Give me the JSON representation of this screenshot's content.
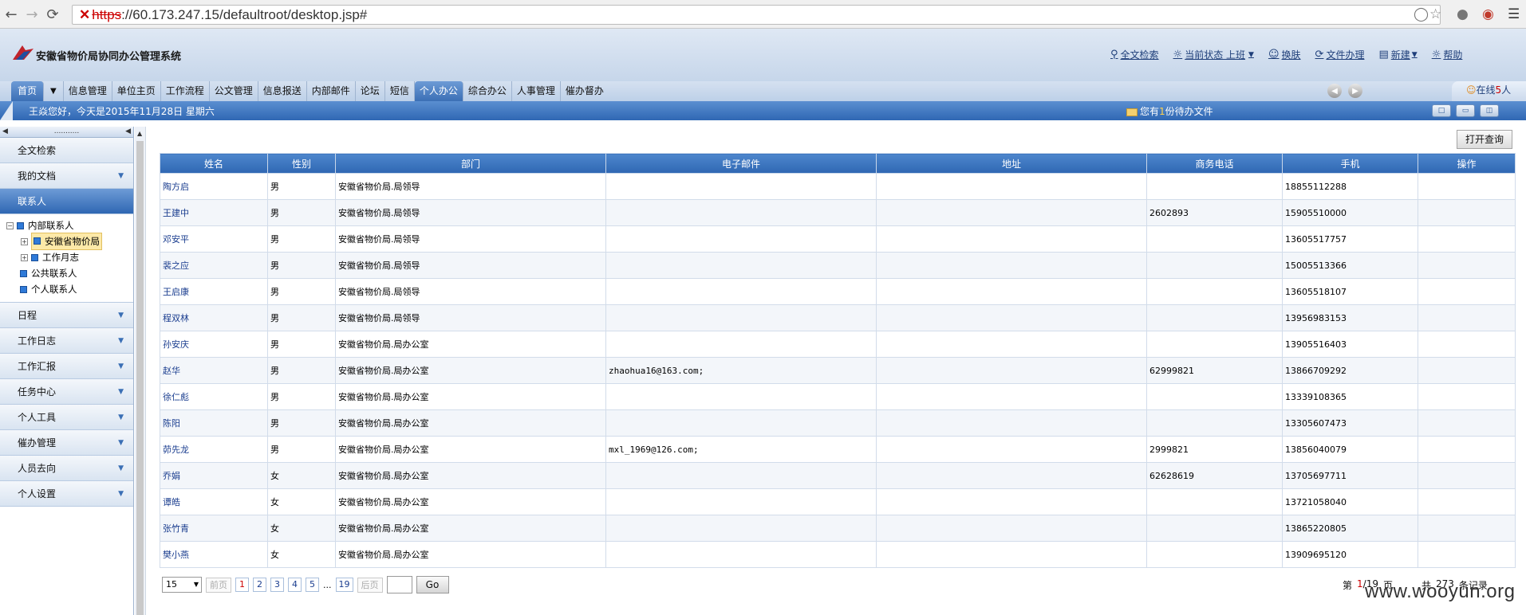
{
  "browser": {
    "url_scheme": "https",
    "url_rest": "://60.173.247.15/defaultroot/desktop.jsp#"
  },
  "app": {
    "title": "安徽省物价局协同办公管理系统",
    "header_links": [
      {
        "label": "全文检索",
        "icon": "search-icon"
      },
      {
        "label": "当前状态 上班",
        "icon": "sun-icon"
      },
      {
        "label": "换肤",
        "icon": "user-icon"
      },
      {
        "label": "文件办理",
        "icon": "refresh-icon"
      },
      {
        "label": "新建",
        "icon": "document-icon"
      },
      {
        "label": "帮助",
        "icon": "bulb-icon"
      }
    ]
  },
  "nav": {
    "items": [
      "首页",
      "信息管理",
      "单位主页",
      "工作流程",
      "公文管理",
      "信息报送",
      "内部邮件",
      "论坛",
      "短信",
      "个人办公",
      "综合办公",
      "人事管理",
      "催办督办"
    ],
    "active": "个人办公",
    "online_label": "在线",
    "online_count": "5",
    "online_suffix": "人"
  },
  "welcome": {
    "greeting": "王焱您好，今天是2015年11月28日 星期六",
    "pending_prefix": "您有",
    "pending_count": "1",
    "pending_suffix": "份待办文件"
  },
  "sidebar": {
    "collapse_dots": "...........",
    "top_items": [
      "全文检索",
      "我的文档"
    ],
    "contacts_label": "联系人",
    "tree": {
      "internal": "内部联系人",
      "org": "安徽省物价局",
      "log": "工作月志",
      "public": "公共联系人",
      "personal": "个人联系人"
    },
    "bottom_items": [
      "日程",
      "工作日志",
      "工作汇报",
      "任务中心",
      "个人工具",
      "催办管理",
      "人员去向",
      "个人设置"
    ]
  },
  "content": {
    "open_search_label": "打开查询",
    "columns": [
      "姓名",
      "性别",
      "部门",
      "电子邮件",
      "地址",
      "商务电话",
      "手机",
      "操作"
    ],
    "rows": [
      {
        "name": "陶方启",
        "sex": "男",
        "dept": "安徽省物价局.局领导",
        "email": "",
        "addr": "",
        "phone": "",
        "mobile": "18855112288"
      },
      {
        "name": "王建中",
        "sex": "男",
        "dept": "安徽省物价局.局领导",
        "email": "",
        "addr": "",
        "phone": "2602893",
        "mobile": "15905510000"
      },
      {
        "name": "邓安平",
        "sex": "男",
        "dept": "安徽省物价局.局领导",
        "email": "",
        "addr": "",
        "phone": "",
        "mobile": "13605517757"
      },
      {
        "name": "裴之应",
        "sex": "男",
        "dept": "安徽省物价局.局领导",
        "email": "",
        "addr": "",
        "phone": "",
        "mobile": "15005513366"
      },
      {
        "name": "王启康",
        "sex": "男",
        "dept": "安徽省物价局.局领导",
        "email": "",
        "addr": "",
        "phone": "",
        "mobile": "13605518107"
      },
      {
        "name": "程双林",
        "sex": "男",
        "dept": "安徽省物价局.局领导",
        "email": "",
        "addr": "",
        "phone": "",
        "mobile": "13956983153"
      },
      {
        "name": "孙安庆",
        "sex": "男",
        "dept": "安徽省物价局.局办公室",
        "email": "",
        "addr": "",
        "phone": "",
        "mobile": "13905516403"
      },
      {
        "name": "赵华",
        "sex": "男",
        "dept": "安徽省物价局.局办公室",
        "email": "zhaohua16@163.com;",
        "addr": "",
        "phone": "62999821",
        "mobile": "13866709292"
      },
      {
        "name": "徐仁彪",
        "sex": "男",
        "dept": "安徽省物价局.局办公室",
        "email": "",
        "addr": "",
        "phone": "",
        "mobile": "13339108365"
      },
      {
        "name": "陈阳",
        "sex": "男",
        "dept": "安徽省物价局.局办公室",
        "email": "",
        "addr": "",
        "phone": "",
        "mobile": "13305607473"
      },
      {
        "name": "茆先龙",
        "sex": "男",
        "dept": "安徽省物价局.局办公室",
        "email": "mxl_1969@126.com;",
        "addr": "",
        "phone": "2999821",
        "mobile": "13856040079"
      },
      {
        "name": "乔娟",
        "sex": "女",
        "dept": "安徽省物价局.局办公室",
        "email": "",
        "addr": "",
        "phone": "62628619",
        "mobile": "13705697711"
      },
      {
        "name": "谭皓",
        "sex": "女",
        "dept": "安徽省物价局.局办公室",
        "email": "",
        "addr": "",
        "phone": "",
        "mobile": "13721058040"
      },
      {
        "name": "张竹青",
        "sex": "女",
        "dept": "安徽省物价局.局办公室",
        "email": "",
        "addr": "",
        "phone": "",
        "mobile": "13865220805"
      },
      {
        "name": "樊小燕",
        "sex": "女",
        "dept": "安徽省物价局.局办公室",
        "email": "",
        "addr": "",
        "phone": "",
        "mobile": "13909695120"
      }
    ]
  },
  "pager": {
    "page_size": "15",
    "prev": "前页",
    "pages": [
      "1",
      "2",
      "3",
      "4",
      "5"
    ],
    "ellipsis": "...",
    "last": "19",
    "next": "后页",
    "go": "Go",
    "di": "第",
    "current": "1",
    "total_pages": "/19",
    "ye": "页",
    "gong": "共",
    "total_records": "273",
    "records_label": "条记录"
  },
  "watermark": "www.wooyun.org"
}
